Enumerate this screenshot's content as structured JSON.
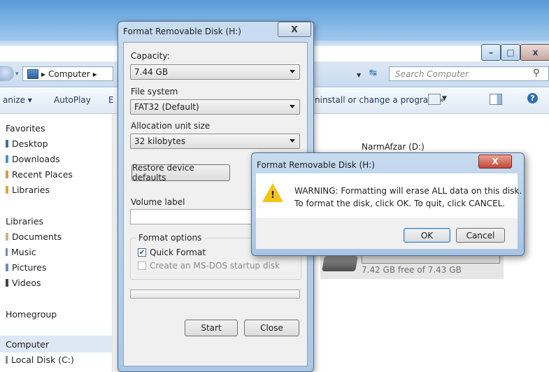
{
  "explorer": {
    "address": {
      "crumb": "Computer",
      "sep": "▸"
    },
    "search": {
      "placeholder": "Search Computer"
    },
    "toolbar": {
      "organize": "anize ▾",
      "autoplay": "AutoPlay",
      "eject_partial": "E",
      "uninstall": "ninstall or change a program",
      "more": "»"
    },
    "nav": {
      "favorites": "Favorites",
      "desktop": "Desktop",
      "downloads": "Downloads",
      "recent": "Recent Places",
      "libraries_fav": "Libraries",
      "libraries": "Libraries",
      "documents": "Documents",
      "music": "Music",
      "pictures": "Pictures",
      "videos": "Videos",
      "homegroup": "Homegroup",
      "computer": "Computer",
      "local_disk": "Local Disk (C:)"
    },
    "content": {
      "drive_d": "NarmAfzar (D:)",
      "drive_h_free": "7.42 GB free of 7.43 GB"
    }
  },
  "format_dialog": {
    "title": "Format Removable Disk (H:)",
    "close": "X",
    "capacity_label": "Capacity:",
    "capacity_value": "7.44 GB",
    "filesystem_label": "File system",
    "filesystem_value": "FAT32 (Default)",
    "allocation_label": "Allocation unit size",
    "allocation_value": "32 kilobytes",
    "restore_button": "Restore device defaults",
    "volume_label": "Volume label",
    "volume_value": "",
    "options_label": "Format options",
    "quick_format": "Quick Format",
    "quick_format_checked": true,
    "msdos": "Create an MS-DOS startup disk",
    "start_button": "Start",
    "close_button": "Close"
  },
  "warning_dialog": {
    "title": "Format Removable Disk (H:)",
    "close": "X",
    "line1": "WARNING: Formatting will erase ALL data on this disk.",
    "line2": "To format the disk, click OK. To quit, click CANCEL.",
    "ok": "OK",
    "cancel": "Cancel"
  }
}
